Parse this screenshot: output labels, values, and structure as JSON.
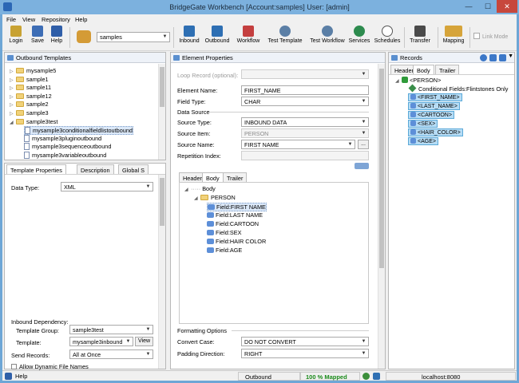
{
  "window": {
    "title": "BridgeGate Workbench [Account:samples] User: [admin]",
    "minimize": "—",
    "maximize": "☐",
    "close": "✕"
  },
  "menu": [
    "File",
    "View",
    "Repository",
    "Help"
  ],
  "toolbar": {
    "login": "Login",
    "save": "Save",
    "help": "Help",
    "account": "samples",
    "inbound": "Inbound",
    "outbound": "Outbound",
    "workflow": "Workflow",
    "test_template": "Test Template",
    "test_workflow": "Test Workflow",
    "services": "Services",
    "schedules": "Schedules",
    "transfer": "Transfer",
    "mapping": "Mapping",
    "link_mode": "Link Mode"
  },
  "outbound_templates": {
    "title": "Outbound Templates",
    "items": [
      {
        "label": "mysample5",
        "type": "folder",
        "expanded": false
      },
      {
        "label": "sample1",
        "type": "folder",
        "expanded": false
      },
      {
        "label": "sample11",
        "type": "folder",
        "expanded": false
      },
      {
        "label": "sample12",
        "type": "folder",
        "expanded": false
      },
      {
        "label": "sample2",
        "type": "folder",
        "expanded": false
      },
      {
        "label": "sample3",
        "type": "folder",
        "expanded": false
      },
      {
        "label": "sample3test",
        "type": "folder",
        "expanded": true
      },
      {
        "label": "mysample3conditionalfieldlistoutbound",
        "type": "doc",
        "selected": true
      },
      {
        "label": "mysample3pluginoutbound",
        "type": "doc"
      },
      {
        "label": "mysample3sequenceoutbound",
        "type": "doc"
      },
      {
        "label": "mysample3variableoutbound",
        "type": "doc"
      }
    ]
  },
  "template_properties": {
    "tabs": [
      "Template Properties",
      "Description",
      "Global S"
    ],
    "data_type_label": "Data Type:",
    "data_type": "XML",
    "inbound_dependency": "Inbound Dependency:",
    "template_group_label": "Template Group:",
    "template_group": "sample3test",
    "template_label": "Template:",
    "template": "mysample3inbound",
    "view_button": "View",
    "send_records_label": "Send Records:",
    "send_records": "All at Once",
    "allow_dynamic": "Allow Dynamic File Names"
  },
  "element_properties": {
    "title": "Element Properties",
    "loop_record_label": "Loop Record (optional):",
    "element_name_label": "Element Name:",
    "element_name": "FIRST_NAME",
    "field_type_label": "Field Type:",
    "field_type": "CHAR",
    "data_source": "Data Source",
    "source_type_label": "Source Type:",
    "source_type": "INBOUND DATA",
    "source_item_label": "Source Item:",
    "source_item": "PERSON",
    "source_name_label": "Source Name:",
    "source_name": "FIRST NAME",
    "source_name_btn": "...",
    "repetition_label": "Repetition Index:",
    "tree_tabs": [
      "Header",
      "Body",
      "Trailer"
    ],
    "tree": {
      "root": "Body",
      "record": "PERSON",
      "fields": [
        "Field:FIRST NAME",
        "Field:LAST NAME",
        "Field:CARTOON",
        "Field:SEX",
        "Field:HAIR COLOR",
        "Field:AGE"
      ]
    },
    "formatting_options": "Formatting Options",
    "convert_case_label": "Convert Case:",
    "convert_case": "DO NOT CONVERT",
    "padding_label": "Padding Direction:",
    "padding": "RIGHT"
  },
  "records": {
    "title": "Records",
    "tabs": [
      "Header",
      "Body",
      "Trailer"
    ],
    "root": "<PERSON>",
    "conditional": "Conditional Fields:Flintstones Only",
    "fields": [
      "<FIRST_NAME>",
      "<LAST_NAME>",
      "<CARTOON>",
      "<SEX>",
      "<HAIR_COLOR>",
      "<AGE>"
    ]
  },
  "status": {
    "help": "Help",
    "mode": "Outbound",
    "mapped": "100 %  Mapped",
    "server": "localhost:8080"
  },
  "colors": {
    "titlebar": "#7cb1de",
    "accent": "#2b67b5",
    "selection": "#b6dcf5",
    "mapped_text": "#1a8a1a"
  }
}
